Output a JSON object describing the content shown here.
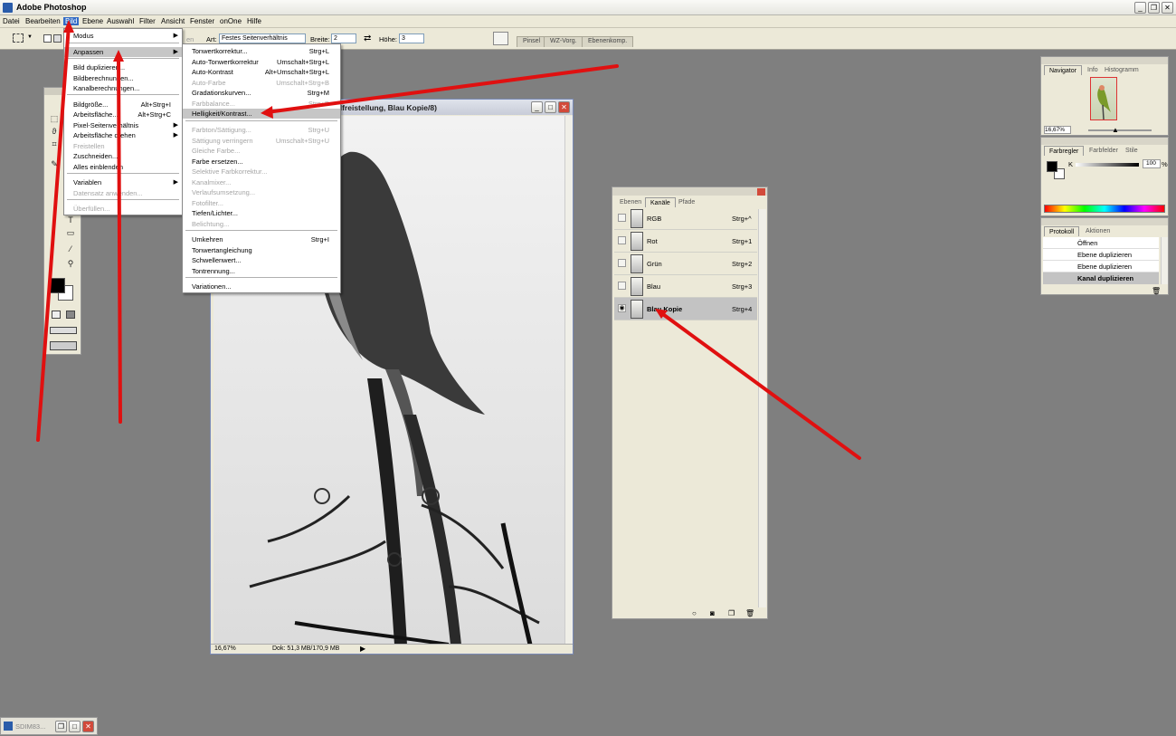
{
  "app": {
    "title": "Adobe Photoshop"
  },
  "menubar": [
    "Datei",
    "Bearbeiten",
    "Bild",
    "Ebene",
    "Auswahl",
    "Filter",
    "Ansicht",
    "Fenster",
    "onOne",
    "Hilfe"
  ],
  "optbar": {
    "art_label": "Art:",
    "art_value": "Festes Seitenverhältnis",
    "breite_label": "Breite:",
    "breite_value": "2",
    "hoehe_label": "Höhe:",
    "hoehe_value": "3",
    "hidden_label": "en",
    "palette_tabs": [
      "Pinsel",
      "WZ-Vorg.",
      "Ebenenkomp."
    ]
  },
  "bild_menu": [
    {
      "label": "Modus",
      "shortcut": "",
      "disabled": false,
      "submenu": true
    },
    {
      "label": "Anpassen",
      "shortcut": "",
      "disabled": false,
      "submenu": true,
      "highlight": true
    },
    {
      "label": "Bild duplizieren...",
      "shortcut": "",
      "disabled": false
    },
    {
      "label": "Bildberechnungen...",
      "shortcut": "",
      "disabled": false
    },
    {
      "label": "Kanalberechnungen...",
      "shortcut": "",
      "disabled": false
    },
    {
      "label": "Bildgröße...",
      "shortcut": "Alt+Strg+I",
      "disabled": false
    },
    {
      "label": "Arbeitsfläche...",
      "shortcut": "Alt+Strg+C",
      "disabled": false
    },
    {
      "label": "Pixel-Seitenverhältnis",
      "shortcut": "",
      "disabled": false,
      "submenu": true
    },
    {
      "label": "Arbeitsfläche drehen",
      "shortcut": "",
      "disabled": false,
      "submenu": true
    },
    {
      "label": "Freistellen",
      "shortcut": "",
      "disabled": true
    },
    {
      "label": "Zuschneiden...",
      "shortcut": "",
      "disabled": false
    },
    {
      "label": "Alles einblenden",
      "shortcut": "",
      "disabled": false
    },
    {
      "label": "Variablen",
      "shortcut": "",
      "disabled": false,
      "submenu": true
    },
    {
      "label": "Datensatz anwenden...",
      "shortcut": "",
      "disabled": true
    },
    {
      "label": "Überfüllen...",
      "shortcut": "",
      "disabled": true
    }
  ],
  "anpassen_menu": [
    {
      "label": "Tonwertkorrektur...",
      "shortcut": "Strg+L",
      "disabled": false
    },
    {
      "label": "Auto-Tonwertkorrektur",
      "shortcut": "Umschalt+Strg+L",
      "disabled": false
    },
    {
      "label": "Auto-Kontrast",
      "shortcut": "Alt+Umschalt+Strg+L",
      "disabled": false
    },
    {
      "label": "Auto-Farbe",
      "shortcut": "Umschalt+Strg+B",
      "disabled": true
    },
    {
      "label": "Gradationskurven...",
      "shortcut": "Strg+M",
      "disabled": false
    },
    {
      "label": "Farbbalance...",
      "shortcut": "Strg+B",
      "disabled": true
    },
    {
      "label": "Helligkeit/Kontrast...",
      "shortcut": "",
      "disabled": false,
      "highlight": true
    },
    {
      "label": "Farbton/Sättigung...",
      "shortcut": "Strg+U",
      "disabled": true
    },
    {
      "label": "Sättigung verringern",
      "shortcut": "Umschalt+Strg+U",
      "disabled": true
    },
    {
      "label": "Gleiche Farbe...",
      "shortcut": "",
      "disabled": true
    },
    {
      "label": "Farbe ersetzen...",
      "shortcut": "",
      "disabled": false
    },
    {
      "label": "Selektive Farbkorrektur...",
      "shortcut": "",
      "disabled": true
    },
    {
      "label": "Kanalmixer...",
      "shortcut": "",
      "disabled": true
    },
    {
      "label": "Verlaufsumsetzung...",
      "shortcut": "",
      "disabled": true
    },
    {
      "label": "Fotofilter...",
      "shortcut": "",
      "disabled": true
    },
    {
      "label": "Tiefen/Lichter...",
      "shortcut": "",
      "disabled": false
    },
    {
      "label": "Belichtung...",
      "shortcut": "",
      "disabled": true
    },
    {
      "label": "Umkehren",
      "shortcut": "Strg+I",
      "disabled": false
    },
    {
      "label": "Tonwertangleichung",
      "shortcut": "",
      "disabled": false
    },
    {
      "label": "Schwellenwert...",
      "shortcut": "",
      "disabled": false
    },
    {
      "label": "Tontrennung...",
      "shortcut": "",
      "disabled": false
    },
    {
      "label": "Variationen...",
      "shortcut": "",
      "disabled": false
    }
  ],
  "image_window": {
    "title": "alfreistellung, Blau Kopie/8)",
    "zoom": "16,67%",
    "doc_info": "Dok: 51,3 MB/170,9 MB"
  },
  "channels_panel": {
    "tabs": [
      "Ebenen",
      "Kanäle",
      "Pfade"
    ],
    "active_tab": "Kanäle",
    "rows": [
      {
        "name": "RGB",
        "shortcut": "Strg+^",
        "visible": false,
        "selected": false
      },
      {
        "name": "Rot",
        "shortcut": "Strg+1",
        "visible": false,
        "selected": false
      },
      {
        "name": "Grün",
        "shortcut": "Strg+2",
        "visible": false,
        "selected": false
      },
      {
        "name": "Blau",
        "shortcut": "Strg+3",
        "visible": false,
        "selected": false
      },
      {
        "name": "Blau Kopie",
        "shortcut": "Strg+4",
        "visible": true,
        "selected": true
      }
    ]
  },
  "navigator_panel": {
    "tabs": [
      "Navigator",
      "Info",
      "Histogramm"
    ],
    "zoom": "16,67%"
  },
  "color_panel": {
    "tabs": [
      "Farbregler",
      "Farbfelder",
      "Stile"
    ],
    "channel_label": "K",
    "value": "100",
    "unit": "%"
  },
  "history_panel": {
    "tabs": [
      "Protokoll",
      "Aktionen"
    ],
    "items": [
      "Öffnen",
      "Ebene duplizieren",
      "Ebene duplizieren",
      "Kanal duplizieren"
    ]
  },
  "taskbar": {
    "label": "SDIM83..."
  },
  "colors": {
    "arrow": "#e01010",
    "menu_highlight": "#c6c6c6",
    "background": "#7f7f7f"
  }
}
